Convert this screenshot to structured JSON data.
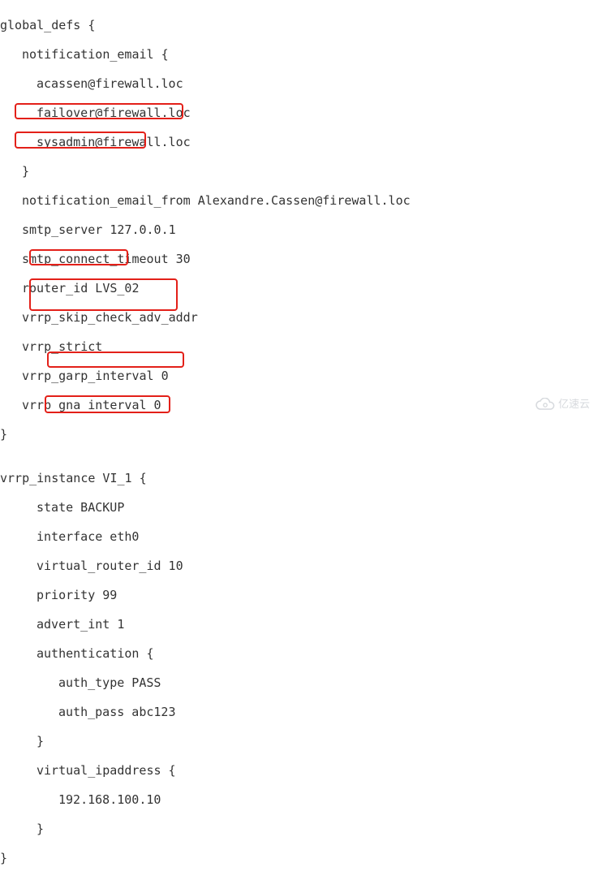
{
  "config": {
    "global_defs_open": "global_defs {",
    "notification_email_open": "notification_email {",
    "emails": [
      "acassen@firewall.loc",
      "failover@firewall.loc",
      "sysadmin@firewall.loc"
    ],
    "notification_email_close": "}",
    "notification_email_from": "notification_email_from Alexandre.Cassen@firewall.loc",
    "smtp_server": "smtp_server 127.0.0.1",
    "smtp_connect_timeout": "smtp_connect_timeout 30",
    "router_id": "router_id LVS_02",
    "vrrp_skip": "vrrp_skip_check_adv_addr",
    "vrrp_strict": "vrrp_strict",
    "vrrp_garp": "vrrp_garp_interval 0",
    "vrrp_gna": "vrrp_gna_interval 0",
    "global_close": "}",
    "blank": "",
    "vrrp_instance_open": "vrrp_instance VI_1 {",
    "state": "state BACKUP",
    "interface": "interface eth0",
    "virtual_router_id": "virtual_router_id 10",
    "priority": "priority 99",
    "advert_int": "advert_int 1",
    "auth_open": "authentication {",
    "auth_type": "auth_type PASS",
    "auth_pass": "auth_pass abc123",
    "auth_close": "}",
    "vip_open": "virtual_ipaddress {",
    "vip": "192.168.100.10",
    "vip_close": "}",
    "vrrp_close": "}"
  },
  "watermark": "亿速云"
}
